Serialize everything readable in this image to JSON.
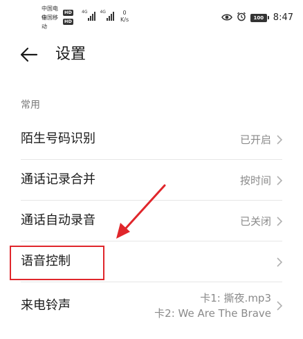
{
  "status_bar": {
    "carriers": [
      {
        "name": "中国电信",
        "badge": "HD"
      },
      {
        "name": "中国移动",
        "badge": "HD"
      }
    ],
    "signals": [
      {
        "label": "4G"
      },
      {
        "label": "4G"
      }
    ],
    "net_speed_value": "0",
    "net_speed_unit": "K/s",
    "battery_level": "100",
    "time": "8:47"
  },
  "header": {
    "title": "设置"
  },
  "section": {
    "label": "常用"
  },
  "items": [
    {
      "label": "陌生号码识别",
      "value": "已开启"
    },
    {
      "label": "通话记录合并",
      "value": "按时间"
    },
    {
      "label": "通话自动录音",
      "value": "已关闭"
    },
    {
      "label": "语音控制",
      "value": ""
    },
    {
      "label": "来电铃声",
      "value_line1": "卡1: 撕夜.mp3",
      "value_line2": "卡2: We Are The Brave"
    }
  ],
  "colors": {
    "highlight": "#e0262b",
    "secondary_text": "#8a8a8a"
  }
}
